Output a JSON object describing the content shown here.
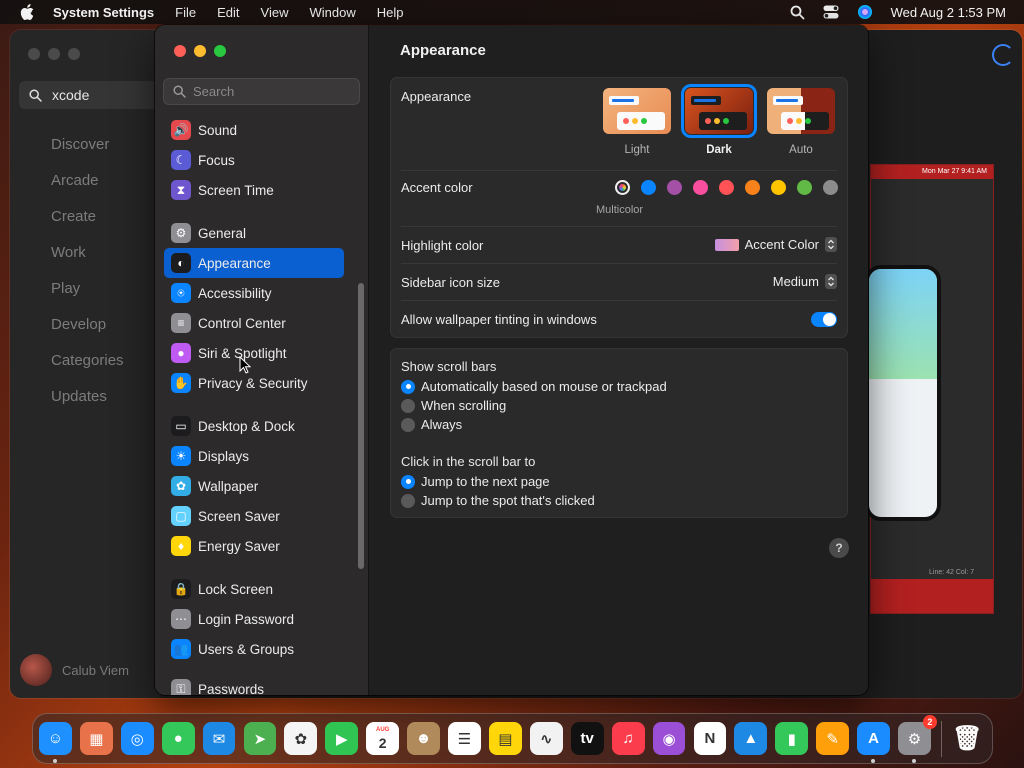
{
  "menubar": {
    "app_name": "System Settings",
    "menus": [
      "File",
      "Edit",
      "View",
      "Window",
      "Help"
    ],
    "clock": "Wed Aug 2  1:53 PM"
  },
  "background_window": {
    "search_value": "xcode",
    "nav": [
      "Discover",
      "Arcade",
      "Create",
      "Work",
      "Play",
      "Develop",
      "Categories",
      "Updates"
    ],
    "user_name": "Calub Viem",
    "xcode_preview": {
      "menu_clock": "Mon Mar 27  9:41 AM",
      "status": "Line: 42  Col: 7"
    }
  },
  "sidebar": {
    "search_placeholder": "Search",
    "items": [
      {
        "label": "Sound",
        "icon": "speaker-icon",
        "color": "#e5484d"
      },
      {
        "label": "Focus",
        "icon": "moon-icon",
        "color": "#5b5bd6"
      },
      {
        "label": "Screen Time",
        "icon": "hourglass-icon",
        "color": "#6e56cf"
      },
      {
        "label": "General",
        "icon": "gear-icon",
        "color": "#8e8e93"
      },
      {
        "label": "Appearance",
        "icon": "appearance-icon",
        "color": "#1c1c1e",
        "selected": true
      },
      {
        "label": "Accessibility",
        "icon": "accessibility-icon",
        "color": "#0a84ff"
      },
      {
        "label": "Control Center",
        "icon": "switches-icon",
        "color": "#8e8e93"
      },
      {
        "label": "Siri & Spotlight",
        "icon": "siri-icon",
        "color": "#bf5af2"
      },
      {
        "label": "Privacy & Security",
        "icon": "hand-icon",
        "color": "#0a84ff"
      },
      {
        "label": "Desktop & Dock",
        "icon": "dock-icon",
        "color": "#1c1c1e"
      },
      {
        "label": "Displays",
        "icon": "sun-icon",
        "color": "#0a84ff"
      },
      {
        "label": "Wallpaper",
        "icon": "flower-icon",
        "color": "#32ade6"
      },
      {
        "label": "Screen Saver",
        "icon": "screen-saver-icon",
        "color": "#64d2ff"
      },
      {
        "label": "Energy Saver",
        "icon": "bulb-icon",
        "color": "#ffd60a"
      },
      {
        "label": "Lock Screen",
        "icon": "lock-icon",
        "color": "#1c1c1e"
      },
      {
        "label": "Login Password",
        "icon": "key-icon",
        "color": "#8e8e93"
      },
      {
        "label": "Users & Groups",
        "icon": "users-icon",
        "color": "#0a84ff"
      },
      {
        "label": "Passwords",
        "icon": "password-key-icon",
        "color": "#8e8e93"
      }
    ]
  },
  "main": {
    "title": "Appearance",
    "appearance": {
      "label": "Appearance",
      "options": [
        "Light",
        "Dark",
        "Auto"
      ],
      "selected": "Dark"
    },
    "accent": {
      "label": "Accent color",
      "colors": [
        "multicolor",
        "#0a84ff",
        "#a550a7",
        "#f74f9e",
        "#ff5257",
        "#f7821b",
        "#ffc600",
        "#62ba46",
        "#8c8c8c"
      ],
      "selected_name": "Multicolor"
    },
    "highlight": {
      "label": "Highlight color",
      "value": "Accent Color"
    },
    "sidebar_icon_size": {
      "label": "Sidebar icon size",
      "value": "Medium"
    },
    "wallpaper_tinting": {
      "label": "Allow wallpaper tinting in windows",
      "enabled": true
    },
    "scroll_bars": {
      "label": "Show scroll bars",
      "options": [
        "Automatically based on mouse or trackpad",
        "When scrolling",
        "Always"
      ],
      "selected": 0
    },
    "scroll_click": {
      "label": "Click in the scroll bar to",
      "options": [
        "Jump to the next page",
        "Jump to the spot that's clicked"
      ],
      "selected": 0
    },
    "help_label": "?"
  },
  "dock": {
    "apps": [
      {
        "name": "Finder",
        "icon": "finder-icon",
        "color": "#1e90ff",
        "glyph": "☺",
        "running": true
      },
      {
        "name": "Launchpad",
        "icon": "launchpad-icon",
        "color": "#e8734a",
        "glyph": "▦"
      },
      {
        "name": "Safari",
        "icon": "safari-icon",
        "color": "#1a8cff",
        "glyph": "◎"
      },
      {
        "name": "Messages",
        "icon": "messages-icon",
        "color": "#34c759",
        "glyph": "●"
      },
      {
        "name": "Mail",
        "icon": "mail-icon",
        "color": "#1e88e5",
        "glyph": "✉"
      },
      {
        "name": "Maps",
        "icon": "maps-icon",
        "color": "#4caf50",
        "glyph": "➤"
      },
      {
        "name": "Photos",
        "icon": "photos-icon",
        "color": "#f5f5f5",
        "glyph": "✿"
      },
      {
        "name": "FaceTime",
        "icon": "facetime-icon",
        "color": "#30c452",
        "glyph": "▶"
      },
      {
        "name": "Calendar",
        "icon": "calendar-icon",
        "color": "#ffffff",
        "glyph": "2",
        "month": "AUG"
      },
      {
        "name": "Contacts",
        "icon": "contacts-icon",
        "color": "#b08a5a",
        "glyph": "☻"
      },
      {
        "name": "Reminders",
        "icon": "reminders-icon",
        "color": "#ffffff",
        "glyph": "☰"
      },
      {
        "name": "Notes",
        "icon": "notes-icon",
        "color": "#ffd60a",
        "glyph": "▤"
      },
      {
        "name": "Freeform",
        "icon": "freeform-icon",
        "color": "#f2f2f2",
        "glyph": "∿"
      },
      {
        "name": "TV",
        "icon": "tv-icon",
        "color": "#111111",
        "glyph": "tv"
      },
      {
        "name": "Music",
        "icon": "music-icon",
        "color": "#fa3c4c",
        "glyph": "♫"
      },
      {
        "name": "Podcasts",
        "icon": "podcasts-icon",
        "color": "#9a4fd6",
        "glyph": "◉"
      },
      {
        "name": "News",
        "icon": "news-icon",
        "color": "#ffffff",
        "glyph": "N"
      },
      {
        "name": "Keynote",
        "icon": "keynote-icon",
        "color": "#1e88e5",
        "glyph": "▲"
      },
      {
        "name": "Numbers",
        "icon": "numbers-icon",
        "color": "#34c759",
        "glyph": "▮"
      },
      {
        "name": "Pages",
        "icon": "pages-icon",
        "color": "#ff9f0a",
        "glyph": "✎"
      },
      {
        "name": "App Store",
        "icon": "app-store-icon",
        "color": "#1a8cff",
        "glyph": "A",
        "running": true
      },
      {
        "name": "System Settings",
        "icon": "system-settings-icon",
        "color": "#8e8e93",
        "glyph": "⚙",
        "badge": "2",
        "running": true
      },
      {
        "name": "Trash",
        "icon": "trash-icon",
        "color": "transparent",
        "glyph": "🗑"
      }
    ]
  }
}
